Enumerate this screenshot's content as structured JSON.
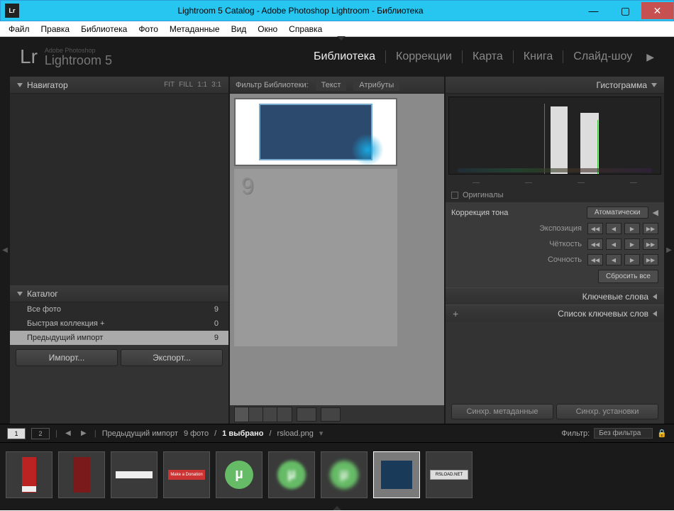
{
  "title": "Lightroom 5 Catalog - Adobe Photoshop Lightroom - Библиотека",
  "menu": [
    "Файл",
    "Правка",
    "Библиотека",
    "Фото",
    "Метаданные",
    "Вид",
    "Окно",
    "Справка"
  ],
  "identity": {
    "lr": "Lr",
    "sub": "Adobe Photoshop",
    "main": "Lightroom 5"
  },
  "modules": [
    "Библиотека",
    "Коррекции",
    "Карта",
    "Книга",
    "Слайд-шоу"
  ],
  "active_module": 0,
  "navigator": {
    "title": "Навигатор",
    "opts": [
      "FIT",
      "FILL",
      "1:1",
      "3:1"
    ]
  },
  "catalog": {
    "title": "Каталог",
    "items": [
      {
        "label": "Все фото",
        "count": "9"
      },
      {
        "label": "Быстрая коллекция  +",
        "count": "0"
      },
      {
        "label": "Предыдущий импорт",
        "count": "9",
        "selected": true
      }
    ]
  },
  "left_buttons": {
    "import": "Импорт...",
    "export": "Экспорт..."
  },
  "filter": {
    "label": "Фильтр Библиотеки:",
    "text": "Текст",
    "attr": "Атрибуты"
  },
  "histogram": {
    "title": "Гистограмма",
    "originals": "Оригиналы"
  },
  "quick_dev": {
    "title": "Коррекция тона",
    "auto": "Атоматически",
    "rows": [
      "Экспозиция",
      "Чёткость",
      "Сочность"
    ],
    "reset": "Сбросить все"
  },
  "right_panels": {
    "keywords": "Ключевые слова",
    "keyword_list": "Список ключевых слов"
  },
  "sync": {
    "meta": "Синхр. метаданные",
    "settings": "Синхр. установки"
  },
  "status": {
    "source": "Предыдущий импорт",
    "count": "9 фото",
    "selected": "1 выбрано",
    "filename": "rsload.png",
    "filter_label": "Фильтр:",
    "filter_value": "Без фильтра"
  },
  "filmstrip": {
    "donate": "Make a Donation",
    "load": "RSLOAD.NET"
  }
}
